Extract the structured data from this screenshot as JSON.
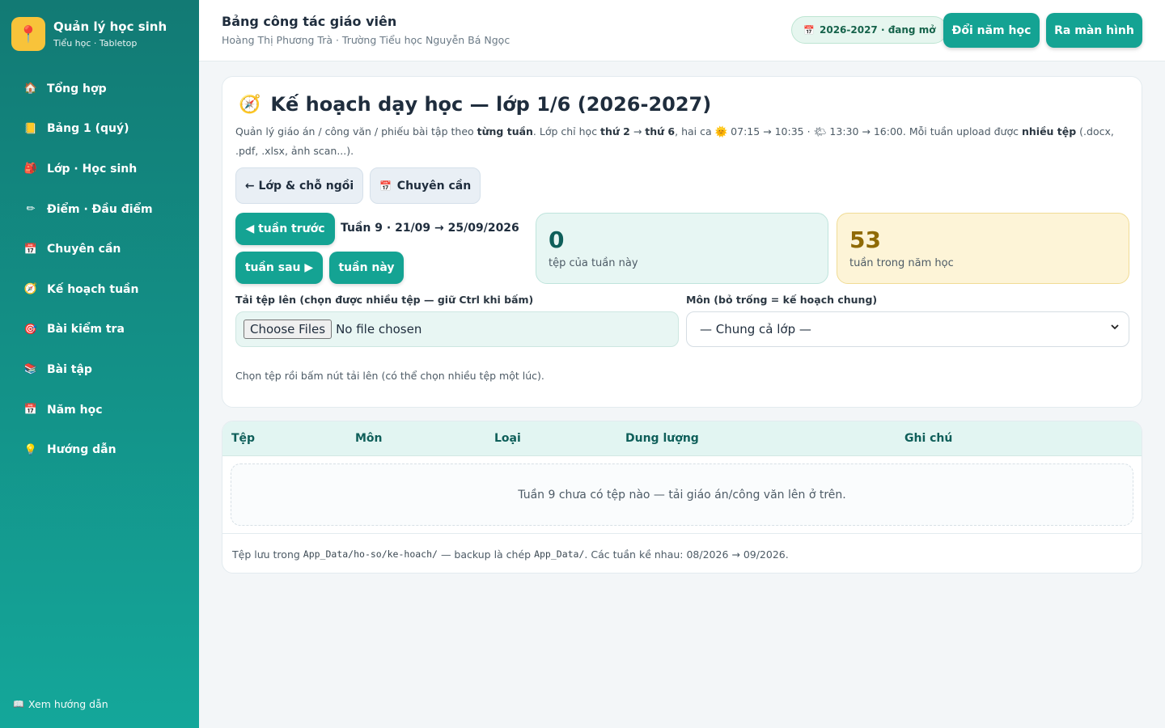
{
  "sidebar": {
    "brand_title": "Quản lý học sinh",
    "brand_sub": "Tiểu học · Tabletop",
    "items": [
      {
        "label": "Tổng hợp",
        "icon": "house-icon",
        "glyph": "🏠"
      },
      {
        "label": "Bảng 1 (quý)",
        "icon": "folder-icon",
        "glyph": "📒"
      },
      {
        "label": "Lớp · Học sinh",
        "icon": "backpack-icon",
        "glyph": "🎒"
      },
      {
        "label": "Điểm · Đầu điểm",
        "icon": "pencil-icon",
        "glyph": "✏"
      },
      {
        "label": "Chuyên cần",
        "icon": "calendar-icon",
        "glyph": "📅"
      },
      {
        "label": "Kế hoạch tuần",
        "icon": "compass-icon",
        "glyph": "🧭"
      },
      {
        "label": "Bài kiểm tra",
        "icon": "target-icon",
        "glyph": "🎯"
      },
      {
        "label": "Bài tập",
        "icon": "books-icon",
        "glyph": "📚"
      },
      {
        "label": "Năm học",
        "icon": "calendar-icon",
        "glyph": "📅"
      },
      {
        "label": "Hướng dẫn",
        "icon": "lightbulb-icon",
        "glyph": "💡"
      }
    ],
    "footer_label": "Xem hướng dẫn"
  },
  "topbar": {
    "title": "Bảng công tác giáo viên",
    "subtitle": "Hoàng Thị Phương Trà · Trường Tiểu học Nguyễn Bá Ngọc",
    "year_badge": "2026-2027 · đang mở",
    "switch_year": "Đổi năm học",
    "exit_screen": "Ra màn hình"
  },
  "plan": {
    "title": "Kế hoạch dạy học — lớp 1/6 (2026-2027)",
    "desc": {
      "p1": "Quản lý giáo án / công văn / phiếu bài tập theo ",
      "b1": "từng tuần",
      "p2": ". Lớp chỉ học ",
      "b2": "thứ 2",
      "p3": " → ",
      "b3": "thứ 6",
      "p4": ", hai ca ",
      "p5": " 07:15 → 10:35 · ",
      "p6": " 13:30 → 16:00. Mỗi tuần upload được ",
      "b4": "nhiều tệp",
      "p7": " (.docx, .pdf, .xlsx, ảnh scan...)."
    },
    "btn_class": "← Lớp & chỗ ngồi",
    "btn_attendance": "Chuyên cần",
    "btn_prev": "◀ tuần trước",
    "btn_next": "tuần sau ▶",
    "btn_this": "tuần này",
    "week_label": "Tuần 9 · 21/09 → 25/09/2026",
    "stat_files_num": "0",
    "stat_files_label": "tệp của tuần này",
    "stat_weeks_num": "53",
    "stat_weeks_label": "tuần trong năm học",
    "upload_label": "Tải tệp lên (chọn được nhiều tệp — giữ Ctrl khi bấm)",
    "file_btn": "Choose Files",
    "file_status": "No file chosen",
    "subject_label": "Môn (bỏ trống = kế hoạch chung)",
    "subject_value": "— Chung cả lớp —",
    "hint": "Chọn tệp rồi bấm nút tải lên (có thể chọn nhiều tệp một lúc)."
  },
  "table": {
    "headers": [
      "Tệp",
      "Môn",
      "Loại",
      "Dung lượng",
      "Ghi chú"
    ],
    "empty": "Tuần 9 chưa có tệp nào — tải giáo án/công văn lên ở trên.",
    "foot": {
      "p1": "Tệp lưu trong ",
      "c1": "App_Data/ho-so/ke-hoach/",
      "p2": " — backup là chép ",
      "c2": "App_Data/",
      "p3": ". Các tuần kề nhau: 08/2026 → 09/2026."
    }
  },
  "colors": {
    "accent": "#14a393",
    "sidebar_top": "#127a74",
    "sidebar_bottom": "#14a79a",
    "files_stat_bg": "#e7f6f3",
    "weeks_stat_bg": "#fdf4d7"
  }
}
